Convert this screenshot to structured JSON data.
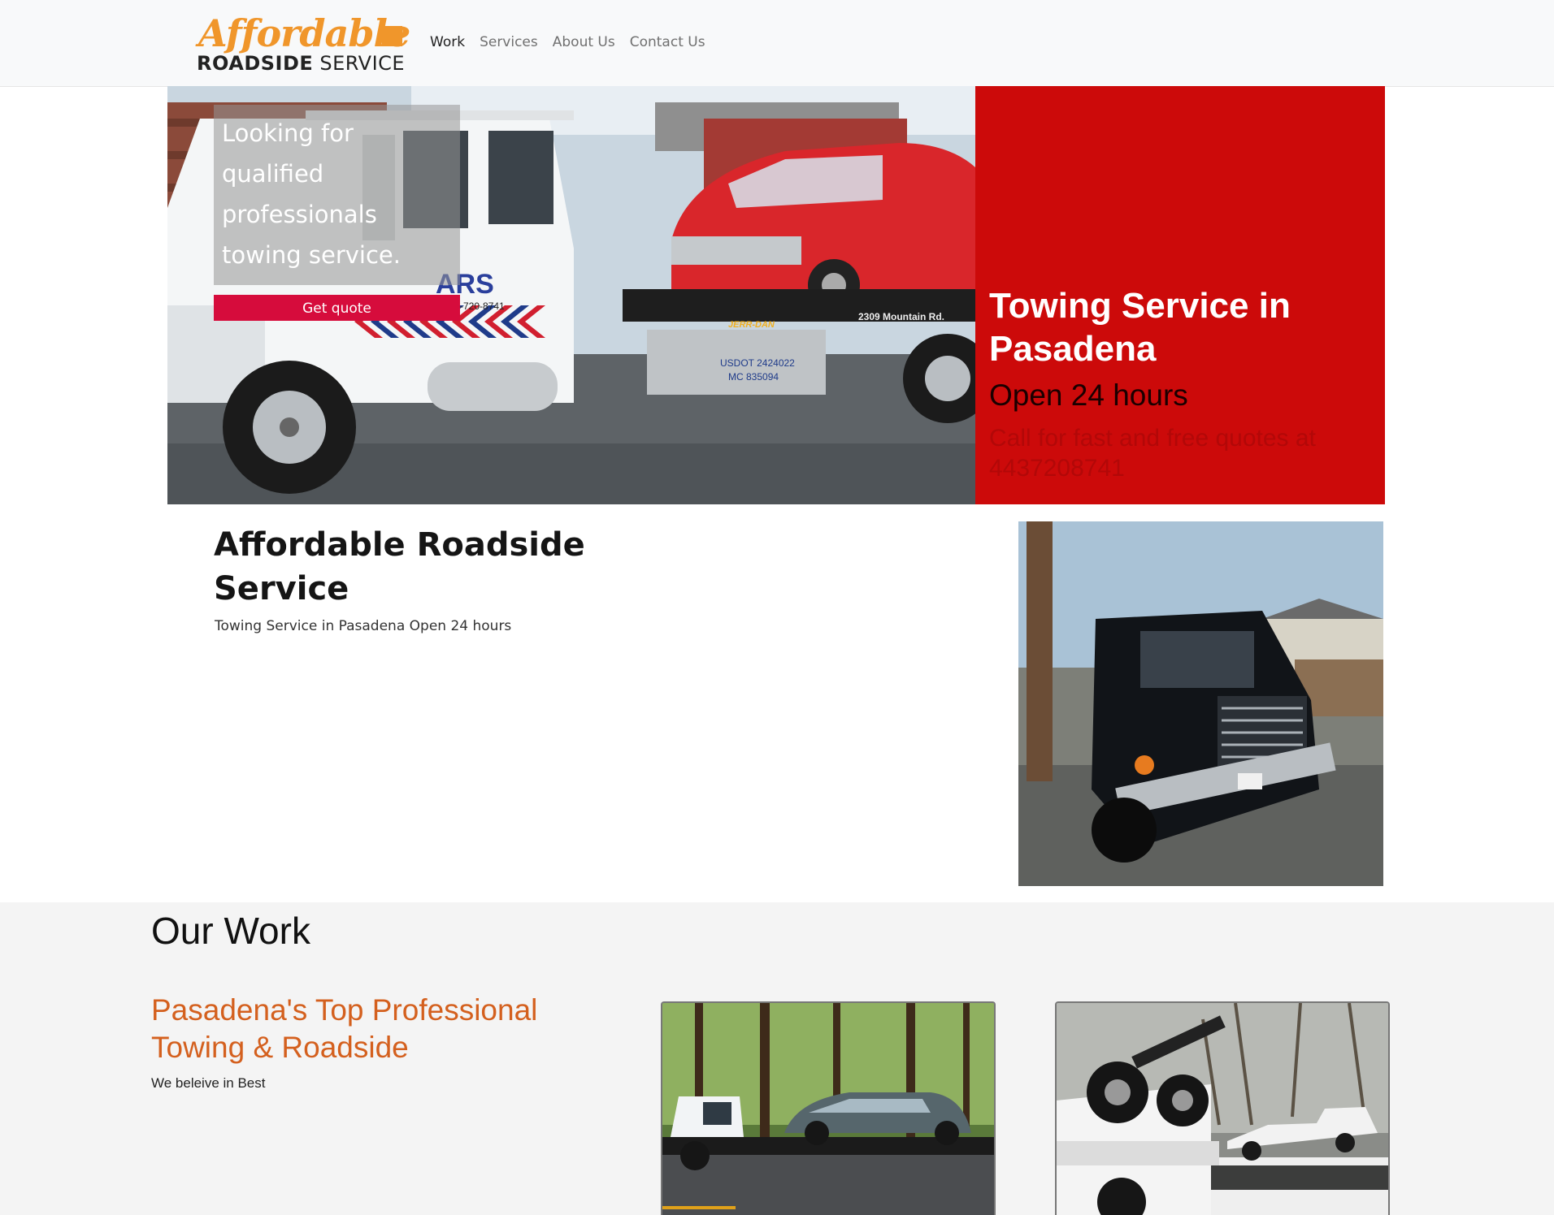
{
  "logo": {
    "line1": "Affordable",
    "line2_bold": "ROADSIDE",
    "line2_light": " SERVICE"
  },
  "nav": {
    "items": [
      "Work",
      "Services",
      "About Us",
      "Contact Us"
    ],
    "active": "Work"
  },
  "hero": {
    "overlay_text": "Looking for qualified professionals towing service.",
    "cta_label": "Get quote",
    "title": "Towing Service in Pasadena",
    "subtitle": "Open 24 hours",
    "call_text": "Call for fast and free quotes at 4437208741",
    "photo_texts": {
      "ars": "ARS",
      "phone": "-720-8741",
      "usdot": "USDOT 2424022",
      "mc": "MC 835094",
      "address": "2309 Mountain Rd.",
      "jerrdan": "JERR-DAN"
    }
  },
  "about": {
    "title": "Affordable Roadside Service",
    "subtitle": "Towing Service in Pasadena Open 24 hours"
  },
  "work": {
    "title": "Our Work",
    "heading": "Pasadena's Top Professional Towing & Roadside",
    "tagline": "We beleive in Best"
  },
  "colors": {
    "accent_red": "#cc0a0a",
    "button_red": "#d60c3c",
    "logo_orange": "#f0962b",
    "heading_orange": "#d4601e"
  }
}
